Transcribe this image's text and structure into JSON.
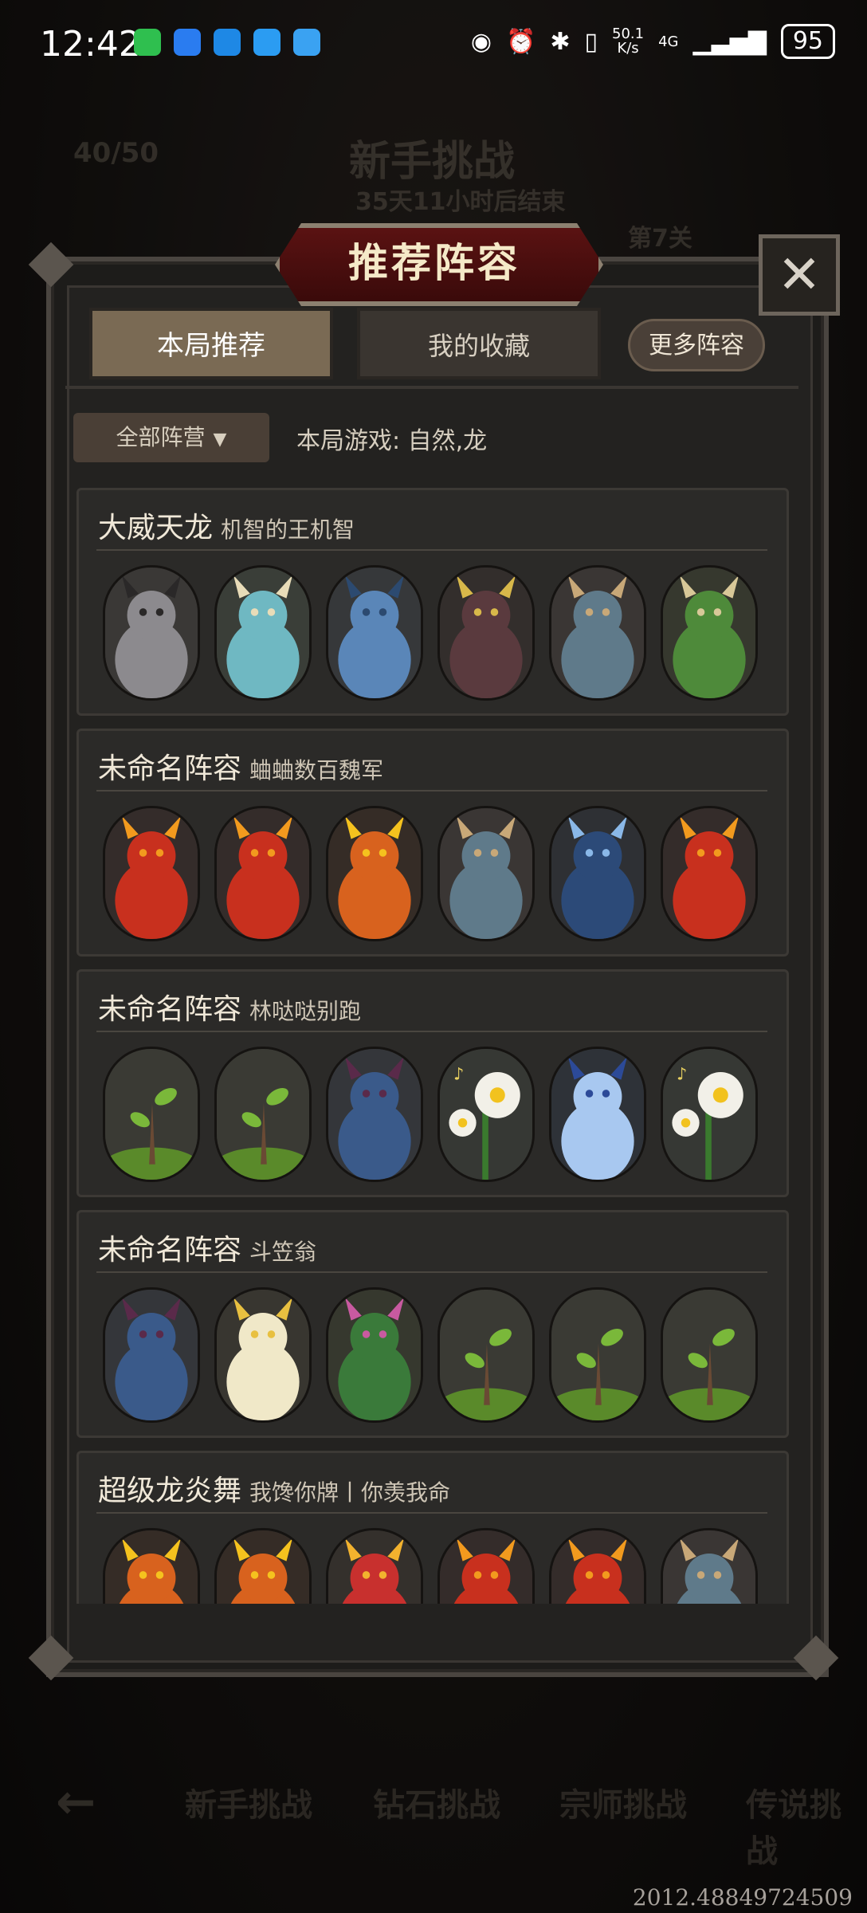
{
  "status_bar": {
    "time": "12:42",
    "net_speed": "50.1\nK/s",
    "signal": "4G",
    "battery": "95"
  },
  "background": {
    "energy": "40/50",
    "title": "新手挑战",
    "timer": "35天11小时后结束",
    "level": "第7关",
    "nav": [
      "新手挑战",
      "钻石挑战",
      "宗师挑战",
      "传说挑战"
    ]
  },
  "modal": {
    "title": "推荐阵容",
    "tabs": [
      {
        "label": "本局推荐",
        "active": true
      },
      {
        "label": "我的收藏",
        "active": false
      }
    ],
    "more_button": "更多阵容",
    "faction_filter": "全部阵营",
    "game_info": "本局游戏: 自然,龙"
  },
  "lineups": [
    {
      "name": "大威天龙",
      "author": "机智的王机智",
      "units": [
        "grey-dragon",
        "jade-dragon",
        "blue-dragon",
        "dark-dragon",
        "horned-beast",
        "green-dragon"
      ]
    },
    {
      "name": "未命名阵容",
      "author": "蛐蛐数百魏军",
      "units": [
        "red-fire-dragon",
        "red-fire-dragon",
        "fire-dragon-gold",
        "horned-beast",
        "storm-dragon",
        "red-fire-dragon"
      ]
    },
    {
      "name": "未命名阵容",
      "author": "林哒哒别跑",
      "units": [
        "sapling",
        "sapling",
        "dark-elf",
        "singing-flower",
        "ice-fairy",
        "singing-flower"
      ]
    },
    {
      "name": "未命名阵容",
      "author": "斗笠翁",
      "units": [
        "dark-elf",
        "flower-fairy",
        "cactus",
        "sapling",
        "sapling",
        "sapling"
      ]
    },
    {
      "name": "超级龙炎舞",
      "author": "我馋你牌丨你羡我命",
      "units": [
        "fire-dragon-gold",
        "fire-dragon-gold",
        "fire-mage",
        "red-fire-dragon",
        "red-fire-dragon",
        "horned-beast"
      ]
    }
  ],
  "coords": "2012.48849724509",
  "colors": {
    "panel": "#232220",
    "card": "#2b2a28",
    "banner": "#5a1212",
    "tab_active": "#7a6a54"
  }
}
